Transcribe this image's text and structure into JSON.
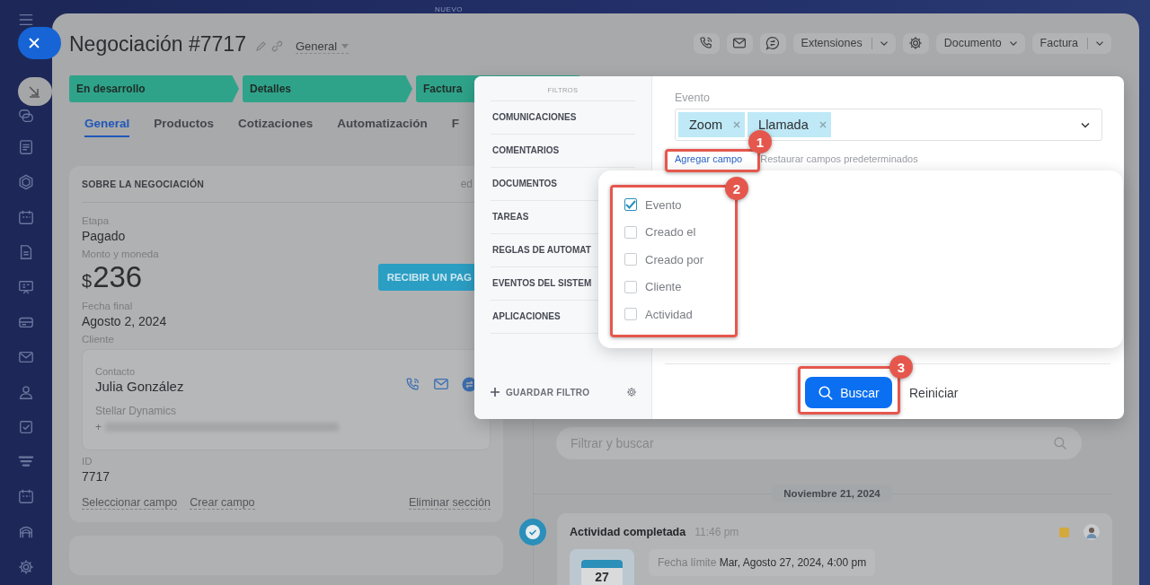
{
  "background_label": "NUEVO",
  "header": {
    "title": "Negociación #7717",
    "category": "General",
    "toolbar": [
      {
        "kind": "split",
        "label": "Extensiones"
      },
      {
        "kind": "dropdown",
        "label": "Documento"
      },
      {
        "kind": "split",
        "label": "Factura"
      }
    ]
  },
  "stages": [
    {
      "label": "En desarrollo"
    },
    {
      "label": "Detalles"
    },
    {
      "label": "Factura"
    }
  ],
  "tabs": [
    {
      "label": "General",
      "selected": true
    },
    {
      "label": "Productos",
      "selected": false
    },
    {
      "label": "Cotizaciones",
      "selected": false
    },
    {
      "label": "Automatización",
      "selected": false
    },
    {
      "label": "F",
      "selected": false
    }
  ],
  "deal_card": {
    "title": "SOBRE LA NEGOCIACIÓN",
    "action": "ed",
    "stage_label": "Etapa",
    "stage_value": "Pagado",
    "amount_label": "Monto y moneda",
    "currency": "$",
    "amount": "236",
    "payment_button": "RECIBIR UN PAG",
    "date_label": "Fecha final",
    "date_value": "Agosto 2, 2024",
    "client_label": "Cliente",
    "contact_label": "Contacto",
    "contact_name": "Julia González",
    "company": "Stellar Dynamics",
    "phone_prefix": "+",
    "id_label": "ID",
    "id_value": "7717",
    "links": [
      {
        "label": "Seleccionar campo"
      },
      {
        "label": "Crear campo"
      },
      {
        "label": "Eliminar sección"
      }
    ]
  },
  "timeline": {
    "search": {
      "placeholder": "Filtrar y buscar"
    },
    "date": "Noviembre 21, 2024",
    "activity": {
      "title": "Actividad completada",
      "time": "11:46 pm",
      "calendar_day": "27",
      "deadline_label": "Fecha límite",
      "deadline_value": "Mar, Agosto 27, 2024, 4:00 pm"
    }
  },
  "filter": {
    "heading": "FILTROS",
    "presets": [
      {
        "label": "COMUNICACIONES"
      },
      {
        "label": "COMENTARIOS"
      },
      {
        "label": "DOCUMENTOS"
      },
      {
        "label": "TAREAS"
      },
      {
        "label": "REGLAS DE AUTOMAT"
      },
      {
        "label": "EVENTOS DEL SISTEM"
      },
      {
        "label": "APLICACIONES"
      }
    ],
    "save_label": "GUARDAR FILTRO",
    "field_label": "Evento",
    "tags": [
      {
        "label": "Zoom"
      },
      {
        "label": "Llamada"
      }
    ],
    "add_field": "Agregar campo",
    "restore_fields": "Restaurar campos predeterminados",
    "field_options": [
      {
        "label": "Evento",
        "checked": true
      },
      {
        "label": "Creado el",
        "checked": false
      },
      {
        "label": "Creado por",
        "checked": false
      },
      {
        "label": "Cliente",
        "checked": false
      },
      {
        "label": "Actividad",
        "checked": false
      }
    ],
    "search_button": "Buscar",
    "reset_button": "Reiniciar"
  },
  "annotations": [
    {
      "number": "1"
    },
    {
      "number": "2"
    },
    {
      "number": "3"
    }
  ]
}
